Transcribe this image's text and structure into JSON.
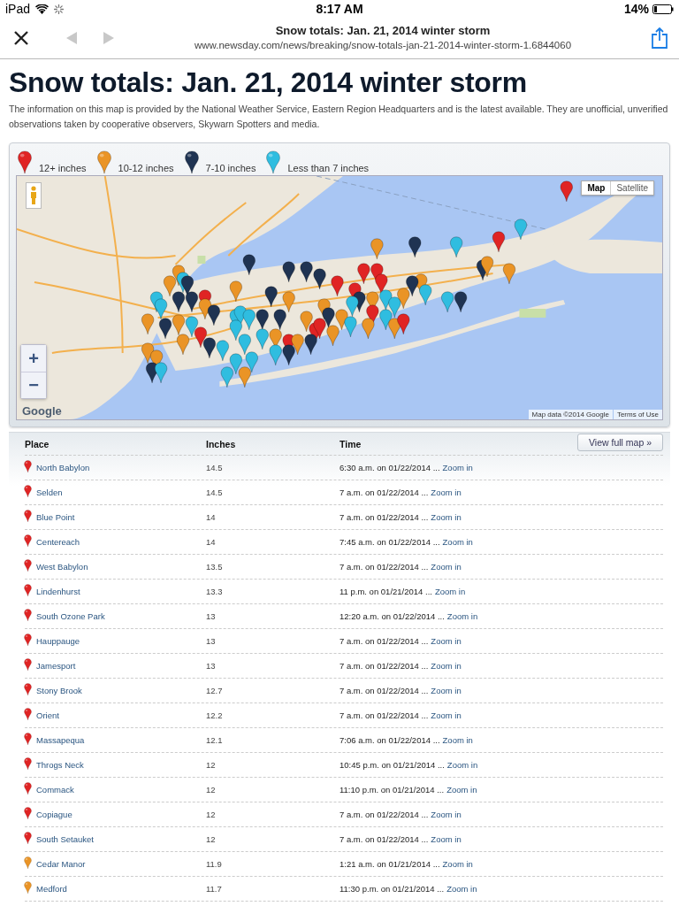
{
  "status_bar": {
    "device": "iPad",
    "time": "8:17 AM",
    "battery": "14%"
  },
  "browser": {
    "title": "Snow totals: Jan. 21, 2014 winter storm",
    "url": "www.newsday.com/news/breaking/snow-totals-jan-21-2014-winter-storm-1.6844060",
    "back": {
      "disabled": true
    },
    "forward": {
      "disabled": true
    }
  },
  "heading": "Snow totals: Jan. 21, 2014 winter storm",
  "description": "The information on this map is provided by the National Weather Service, Eastern Region Headquarters and is the latest available. They are unofficial, unverified observations taken by cooperative observers, Skywarn Spotters and media.",
  "legend": [
    {
      "label": "12+ inches",
      "color": "#e02424"
    },
    {
      "label": "10-12 inches",
      "color": "#ea9426"
    },
    {
      "label": "7-10 inches",
      "color": "#1f3352"
    },
    {
      "label": "Less than 7 inches",
      "color": "#2fbde0"
    }
  ],
  "map": {
    "map_types": [
      {
        "label": "Map",
        "selected": true
      },
      {
        "label": "Satellite",
        "selected": false
      }
    ],
    "zoom_in": "+",
    "zoom_out": "−",
    "attribution": "Map data ©2014 Google",
    "terms": "Terms of Use",
    "logo": "Google"
  },
  "table": {
    "columns": [
      "Place",
      "Inches",
      "Time"
    ],
    "button": "View full map »",
    "rows": [
      {
        "place": "North Babylon",
        "inches": "14.5",
        "time": "6:30 a.m. on 01/22/2014 ...",
        "link": "Zoom in",
        "color": "#e02424"
      },
      {
        "place": "Selden",
        "inches": "14.5",
        "time": "7 a.m. on 01/22/2014 ...",
        "link": "Zoom in",
        "color": "#e02424"
      },
      {
        "place": "Blue Point",
        "inches": "14",
        "time": "7 a.m. on 01/22/2014 ...",
        "link": "Zoom in",
        "color": "#e02424"
      },
      {
        "place": "Centereach",
        "inches": "14",
        "time": "7:45 a.m. on 01/22/2014 ...",
        "link": "Zoom in",
        "color": "#e02424"
      },
      {
        "place": "West Babylon",
        "inches": "13.5",
        "time": "7 a.m. on 01/22/2014 ...",
        "link": "Zoom in",
        "color": "#e02424"
      },
      {
        "place": "Lindenhurst",
        "inches": "13.3",
        "time": "11 p.m. on 01/21/2014 ...",
        "link": "Zoom in",
        "color": "#e02424"
      },
      {
        "place": "South Ozone Park",
        "inches": "13",
        "time": "12:20 a.m. on 01/22/2014 ...",
        "link": "Zoom in",
        "color": "#e02424"
      },
      {
        "place": "Hauppauge",
        "inches": "13",
        "time": "7 a.m. on 01/22/2014 ...",
        "link": "Zoom in",
        "color": "#e02424"
      },
      {
        "place": "Jamesport",
        "inches": "13",
        "time": "7 a.m. on 01/22/2014 ...",
        "link": "Zoom in",
        "color": "#e02424"
      },
      {
        "place": "Stony Brook",
        "inches": "12.7",
        "time": "7 a.m. on 01/22/2014 ...",
        "link": "Zoom in",
        "color": "#e02424"
      },
      {
        "place": "Orient",
        "inches": "12.2",
        "time": "7 a.m. on 01/22/2014 ...",
        "link": "Zoom in",
        "color": "#e02424"
      },
      {
        "place": "Massapequa",
        "inches": "12.1",
        "time": "7:06 a.m. on 01/22/2014 ...",
        "link": "Zoom in",
        "color": "#e02424"
      },
      {
        "place": "Throgs Neck",
        "inches": "12",
        "time": "10:45 p.m. on 01/21/2014 ...",
        "link": "Zoom in",
        "color": "#e02424"
      },
      {
        "place": "Commack",
        "inches": "12",
        "time": "11:10 p.m. on 01/21/2014 ...",
        "link": "Zoom in",
        "color": "#e02424"
      },
      {
        "place": "Copiague",
        "inches": "12",
        "time": "7 a.m. on 01/22/2014 ...",
        "link": "Zoom in",
        "color": "#e02424"
      },
      {
        "place": "South Setauket",
        "inches": "12",
        "time": "7 a.m. on 01/22/2014 ...",
        "link": "Zoom in",
        "color": "#e02424"
      },
      {
        "place": "Cedar Manor",
        "inches": "11.9",
        "time": "1:21 a.m. on 01/21/2014 ...",
        "link": "Zoom in",
        "color": "#ea9426"
      },
      {
        "place": "Medford",
        "inches": "11.7",
        "time": "11:30 p.m. on 01/21/2014 ...",
        "link": "Zoom in",
        "color": "#ea9426"
      }
    ]
  }
}
